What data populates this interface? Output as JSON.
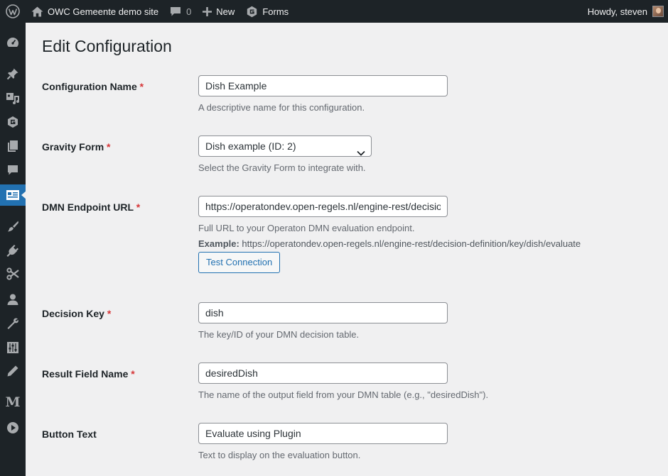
{
  "admin_bar": {
    "site_name": "OWC Gemeente demo site",
    "comments_count": "0",
    "new_label": "New",
    "forms_label": "Forms",
    "howdy": "Howdy, steven"
  },
  "side_menu": {
    "items": [
      "dashboard-icon",
      "posts-pin-icon",
      "media-icon",
      "gravity-forms-icon",
      "pages-icon",
      "comments-icon",
      "configuration-icon",
      "appearance-brush-icon",
      "plugins-icon",
      "tools-scissors-icon",
      "users-icon",
      "settings-wrench-icon",
      "sliders-icon",
      "pencil-icon",
      "m-letter-icon",
      "play-circle-icon"
    ],
    "letter_item": "M",
    "current_item": "configuration-icon",
    "accent_color": "#2271b1"
  },
  "page": {
    "title": "Edit Configuration"
  },
  "form": {
    "config_name": {
      "label": "Configuration Name",
      "required_mark": "*",
      "value": "Dish Example",
      "description": "A descriptive name for this configuration."
    },
    "gravity_form": {
      "label": "Gravity Form",
      "required_mark": "*",
      "selected": "Dish example (ID: 2)",
      "description": "Select the Gravity Form to integrate with."
    },
    "dmn_endpoint": {
      "label": "DMN Endpoint URL",
      "required_mark": "*",
      "value": "https://operatondev.open-regels.nl/engine-rest/decision-definition/key/dish/evaluate",
      "description": "Full URL to your Operaton DMN evaluation endpoint.",
      "example_label": "Example:",
      "example_value": " https://operatondev.open-regels.nl/engine-rest/decision-definition/key/dish/evaluate",
      "test_button": "Test Connection"
    },
    "decision_key": {
      "label": "Decision Key",
      "required_mark": "*",
      "value": "dish",
      "description": "The key/ID of your DMN decision table."
    },
    "result_field": {
      "label": "Result Field Name",
      "required_mark": "*",
      "value": "desiredDish",
      "description": "The name of the output field from your DMN table (e.g., \"desiredDish\")."
    },
    "button_text": {
      "label": "Button Text",
      "value": "Evaluate using Plugin",
      "description": "Text to display on the evaluation button."
    }
  }
}
